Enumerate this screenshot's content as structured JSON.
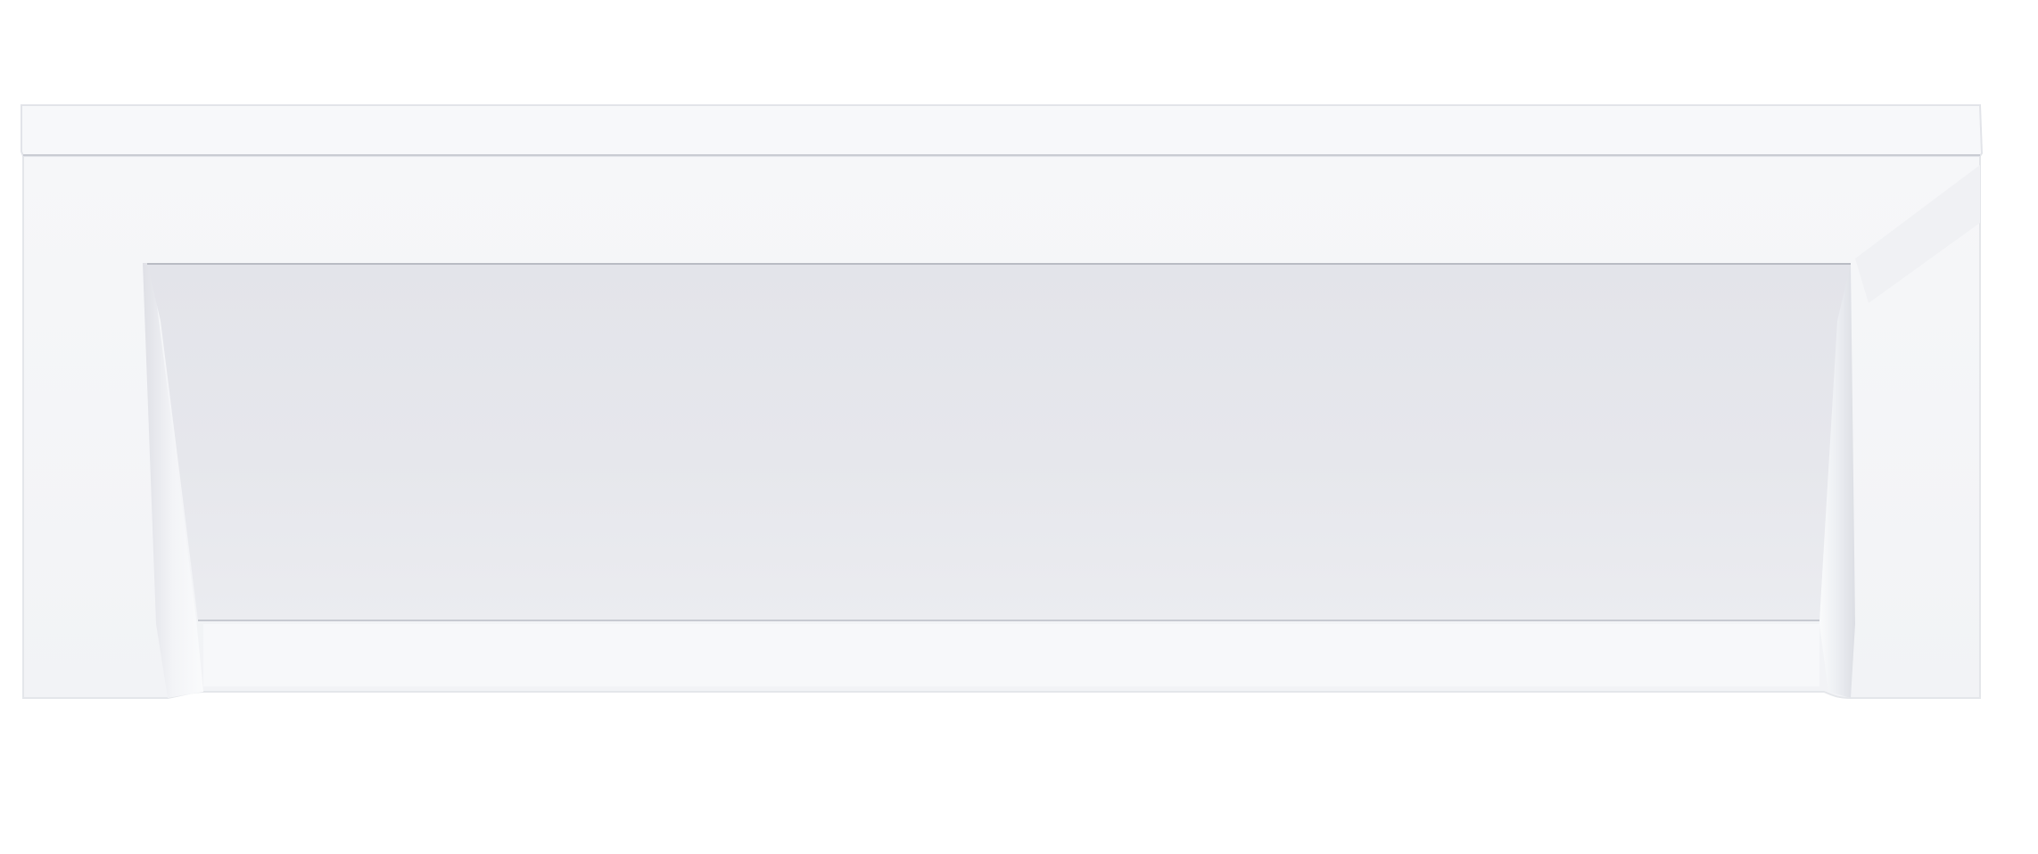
{
  "scene": {
    "subject": "bathtub-front-panel",
    "colors": {
      "background": "#ffffff",
      "frame": "#f4f5f8",
      "top_lip": "#f7f8fa",
      "recess_face": "#e7e8ed",
      "recess_shadow": "#d9dbe1",
      "bevel_highlight": "#fbfcfd",
      "edge_line": "#c9ccd3"
    }
  }
}
